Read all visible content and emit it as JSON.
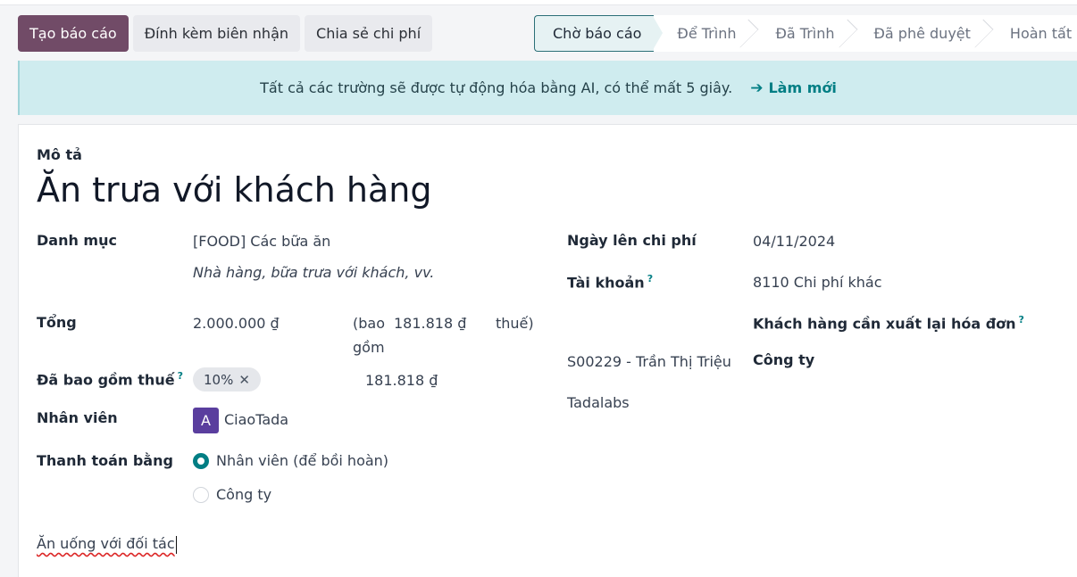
{
  "toolbar": {
    "create_report": "Tạo báo cáo",
    "attach_receipt": "Đính kèm biên nhận",
    "split_expense": "Chia sẻ chi phí"
  },
  "statusbar": {
    "stages": [
      "Chờ báo cáo",
      "Để Trình",
      "Đã Trình",
      "Đã phê duyệt",
      "Hoàn tất"
    ],
    "active": "Chờ báo cáo"
  },
  "banner": {
    "text": "Tất cả các trường sẽ được tự động hóa bằng AI, có thể mất 5 giây.",
    "refresh": "Làm mới"
  },
  "form": {
    "description_label": "Mô tả",
    "title": "Ăn trưa với khách hàng",
    "category_label": "Danh mục",
    "category_value": "[FOOD] Các bữa ăn",
    "category_hint": "Nhà hàng, bữa trưa với khách, vv.",
    "total_label": "Tổng",
    "total_value": "2.000.000 ₫",
    "included_prefix_1": "(bao",
    "included_prefix_2": "gồm",
    "included_tax_amount": "181.818 ₫",
    "included_suffix": "thuế)",
    "tax_included_label": "Đã bao gồm thuế",
    "tax_tag": "10%",
    "tax_amount": "181.818 ₫",
    "employee_label": "Nhân viên",
    "employee_initial": "A",
    "employee_name": "CiaoTada",
    "paid_by_label": "Thanh toán bằng",
    "paid_by_options": [
      "Nhân viên (để bồi hoàn)",
      "Công ty"
    ],
    "expense_date_label": "Ngày lên chi phí",
    "expense_date_value": "04/11/2024",
    "account_label": "Tài khoản",
    "account_value": "8110 Chi phí khác",
    "reinvoice_label": "Khách hàng cần xuất lại hóa đơn",
    "reinvoice_value": "S00229 - Trần Thị Triệu",
    "company_label": "Công ty",
    "company_value": "Tadalabs",
    "tooltip_marker": "?",
    "note": "Ăn uống với đối tác"
  }
}
